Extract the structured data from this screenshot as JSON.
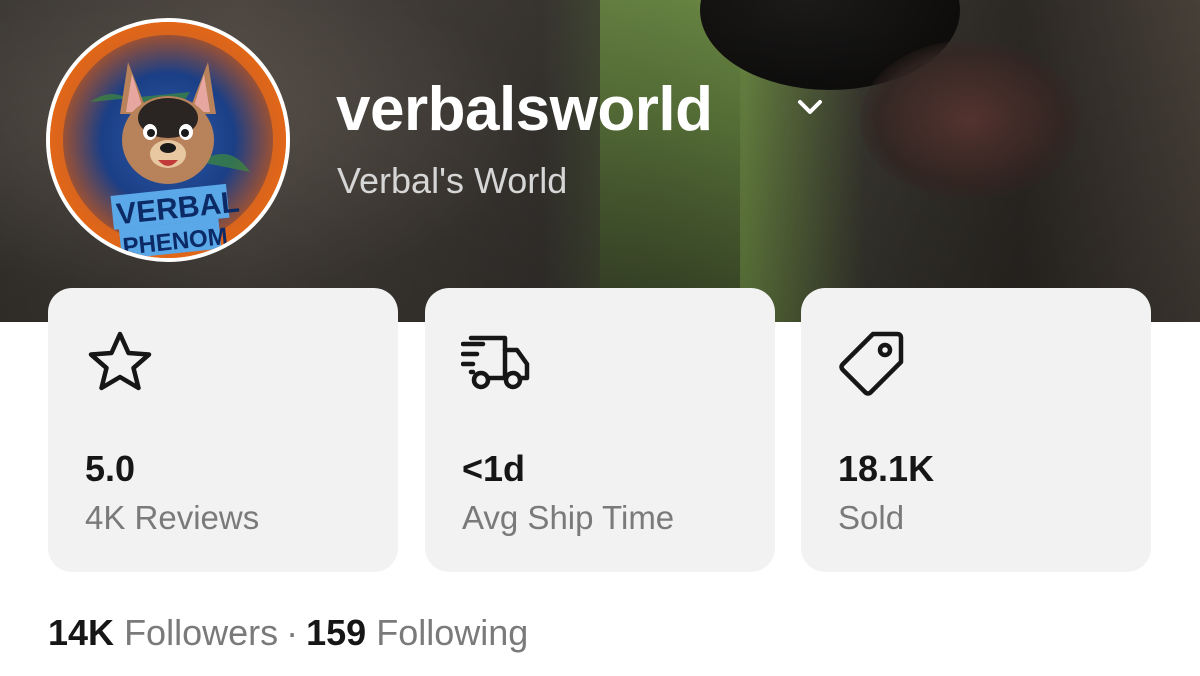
{
  "profile": {
    "username": "verbalsworld",
    "display_name": "Verbal's World",
    "avatar_text": "VERBAL PHENOM"
  },
  "stats": [
    {
      "icon": "star-icon",
      "value": "5.0",
      "label": "4K Reviews"
    },
    {
      "icon": "delivery-truck-icon",
      "value": "<1d",
      "label": "Avg Ship Time"
    },
    {
      "icon": "price-tag-icon",
      "value": "18.1K",
      "label": "Sold"
    }
  ],
  "social": {
    "followers_count": "14K",
    "followers_label": "Followers",
    "separator": "·",
    "following_count": "159",
    "following_label": "Following"
  },
  "colors": {
    "card_background": "#f2f2f2",
    "value_text": "#161616",
    "label_text": "#7a7a7a",
    "username_text": "#ffffff"
  }
}
